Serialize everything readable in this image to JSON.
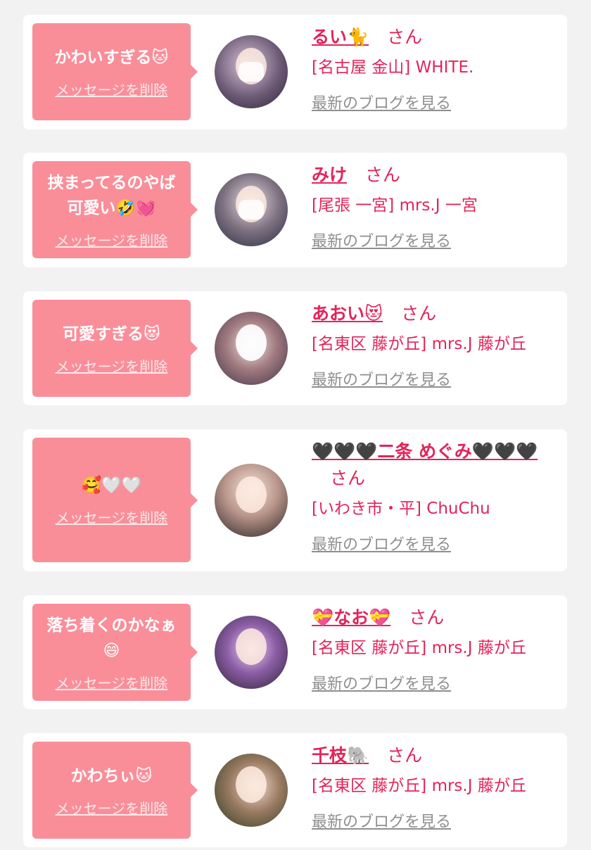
{
  "delete_label": "メッセージを削除",
  "blog_label": "最新のブログを見る",
  "san": "さん",
  "colors": {
    "background": "#f2f2f2",
    "card": "#ffffff",
    "bubble": "#f98e99",
    "name": "#e2245a",
    "link_gray": "#8f8f8f"
  },
  "cards": [
    {
      "message": "かわいすぎる🐱",
      "name": "るい🐈",
      "shop": "[名古屋 金山] WHITE.",
      "avatar": "avatar-photo-1"
    },
    {
      "message": "挟まってるのやば\n可愛い🤣💓",
      "name": "みけ",
      "shop": "[尾張 一宮] mrs.J 一宮",
      "avatar": "avatar-photo-2"
    },
    {
      "message": "可愛すぎる😻",
      "name": "あおい😻",
      "shop": "[名東区 藤が丘] mrs.J 藤が丘",
      "avatar": "avatar-photo-3"
    },
    {
      "message": "🥰🤍🤍",
      "name": "🖤🖤🖤二条 めぐみ🖤🖤🖤",
      "shop": "[いわき市・平] ChuChu",
      "avatar": "avatar-photo-4"
    },
    {
      "message": "落ち着くのかなぁ\n😄",
      "name": "💝なお💝",
      "shop": "[名東区 藤が丘] mrs.J 藤が丘",
      "avatar": "avatar-photo-5"
    },
    {
      "message": "かわちぃ🐱",
      "name": "千枝🐘",
      "shop": "[名東区 藤が丘] mrs.J 藤が丘",
      "avatar": "avatar-photo-6"
    }
  ]
}
